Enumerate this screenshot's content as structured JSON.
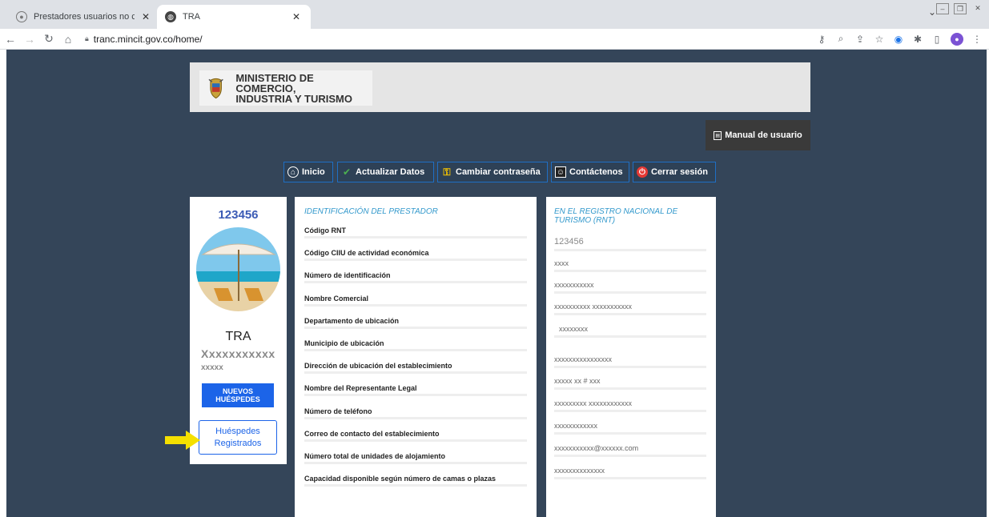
{
  "browser": {
    "tabs": [
      {
        "title": "Prestadores usuarios no conecta",
        "active": false
      },
      {
        "title": "TRA",
        "active": true
      }
    ],
    "url": "tranc.mincit.gov.co/home/"
  },
  "header": {
    "ministry_name": "MINISTERIO DE COMERCIO,\nINDUSTRIA Y TURISMO"
  },
  "manual_button": "Manual de usuario",
  "nav": [
    {
      "label": "Inicio",
      "icon": "home-icon"
    },
    {
      "label": "Actualizar Datos",
      "icon": "checkmark-icon"
    },
    {
      "label": "Cambiar contraseña",
      "icon": "key-icon"
    },
    {
      "label": "Contáctenos",
      "icon": "contact-book-icon"
    },
    {
      "label": "Cerrar sesión",
      "icon": "power-icon"
    }
  ],
  "profile": {
    "rnt_number": "123456",
    "name": "TRA",
    "subtitle_line1": "Xxxxxxxxxxx",
    "subtitle_line2": "xxxxx",
    "nuevos_label": "NUEVOS\nHUÉSPEDES",
    "registrados_label": "Huéspedes\nRegistrados"
  },
  "identification": {
    "title": "IDENTIFICACIÓN DEL PRESTADOR",
    "fields": [
      "Código RNT",
      "Código CIIU de actividad económica",
      "Número de identificación",
      "Nombre Comercial",
      "Departamento de ubicación",
      "Municipio de ubicación",
      "Dirección de ubicación del establecimiento",
      "Nombre del Representante Legal",
      "Número de teléfono",
      "Correo de contacto del establecimiento",
      "Número total de unidades de alojamiento",
      "Capacidad disponible según número de camas o plazas"
    ]
  },
  "rnt": {
    "title": "EN EL REGISTRO NACIONAL DE TURISMO (RNT)",
    "values": [
      "123456",
      "xxxx",
      "xxxxxxxxxxx",
      "xxxxxxxxxx xxxxxxxxxxx",
      "xxxxxxxx",
      "xxxxxxxxxxxxxxxx",
      "xxxxx  xx # xxx",
      "xxxxxxxxx xxxxxxxxxxxx",
      "xxxxxxxxxxxx",
      "xxxxxxxxxxx@xxxxxx.com",
      "xxxxxxxxxxxxxx"
    ]
  },
  "colors": {
    "page_bg": "#344559",
    "accent_blue": "#1c64e8",
    "title_blue": "#3399cc",
    "arrow_yellow": "#f5e000"
  }
}
